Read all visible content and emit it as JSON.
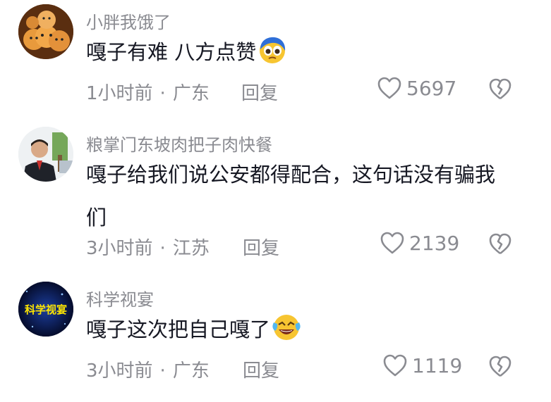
{
  "comments": [
    {
      "username": "小胖我饿了",
      "text": "嘎子有难 八方点赞",
      "emoji": "pleading-face-emoji",
      "time": "1小时前",
      "location": "广东",
      "reply_label": "回复",
      "likes": "5697"
    },
    {
      "username": "粮掌门东坡肉把子肉快餐",
      "text": "嘎子给我们说公安都得配合，这句话没有骗我们",
      "emoji": "",
      "time": "3小时前",
      "location": "江苏",
      "reply_label": "回复",
      "likes": "2139"
    },
    {
      "username": "科学视宴",
      "text": "嘎子这次把自己嘎了",
      "emoji": "laughing-crying-emoji",
      "time": "3小时前",
      "location": "广东",
      "reply_label": "回复",
      "likes": "1119",
      "avatar_text": "科学视宴"
    }
  ],
  "meta_separator": "·",
  "colors": {
    "text_primary": "#161823",
    "text_secondary": "#8a8b91",
    "background": "#ffffff"
  }
}
